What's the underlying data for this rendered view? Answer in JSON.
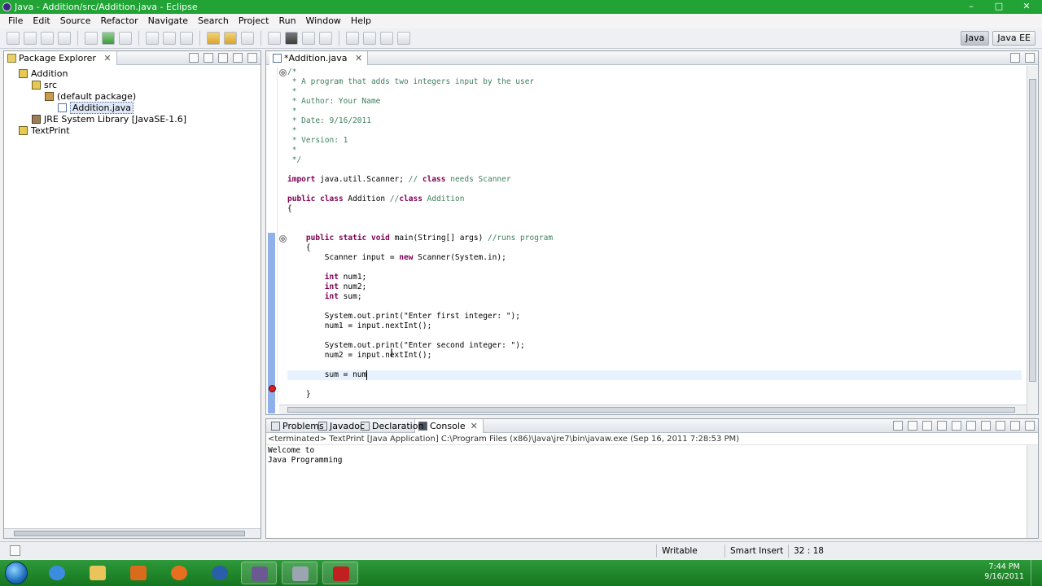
{
  "window": {
    "title": "Java - Addition/src/Addition.java - Eclipse",
    "controls": [
      "–",
      "□",
      "✕"
    ]
  },
  "menubar": [
    "File",
    "Edit",
    "Source",
    "Refactor",
    "Navigate",
    "Search",
    "Project",
    "Run",
    "Window",
    "Help"
  ],
  "perspectives": [
    "Java",
    "Java EE"
  ],
  "package_explorer": {
    "title": "Package Explorer",
    "tree": [
      {
        "label": "Addition",
        "depth": 0,
        "icon": "project-icon"
      },
      {
        "label": "src",
        "depth": 1,
        "icon": "source-folder-icon"
      },
      {
        "label": "(default package)",
        "depth": 2,
        "icon": "package-icon"
      },
      {
        "label": "Addition.java",
        "depth": 3,
        "icon": "java-file-icon",
        "selected": true
      },
      {
        "label": "JRE System Library [JavaSE-1.6]",
        "depth": 1,
        "icon": "library-icon"
      },
      {
        "label": "TextPrint",
        "depth": 0,
        "icon": "project-icon"
      }
    ]
  },
  "editor": {
    "tab": "*Addition.java",
    "lines": [
      {
        "text": "/*",
        "kind": "comment",
        "fold": "⊖"
      },
      {
        "text": " * A program that adds two integers input by the user",
        "kind": "comment"
      },
      {
        "text": " *",
        "kind": "comment"
      },
      {
        "text": " * Author: Your Name",
        "kind": "comment"
      },
      {
        "text": " *",
        "kind": "comment"
      },
      {
        "text": " * Date: 9/16/2011",
        "kind": "comment"
      },
      {
        "text": " *",
        "kind": "comment"
      },
      {
        "text": " * Version: 1",
        "kind": "comment"
      },
      {
        "text": " *",
        "kind": "comment"
      },
      {
        "text": " */",
        "kind": "comment"
      },
      {
        "text": "",
        "kind": "plain"
      },
      {
        "text": "import java.util.Scanner; // class needs Scanner",
        "kind": "plain"
      },
      {
        "text": "",
        "kind": "plain"
      },
      {
        "text": "public class Addition //class Addition",
        "kind": "plain"
      },
      {
        "text": "{",
        "kind": "plain"
      },
      {
        "text": "",
        "kind": "plain"
      },
      {
        "text": "",
        "kind": "plain"
      },
      {
        "text": "    public static void main(String[] args) //runs program",
        "kind": "plain",
        "fold": "⊖"
      },
      {
        "text": "    {",
        "kind": "plain"
      },
      {
        "text": "        Scanner input = new Scanner(System.in);",
        "kind": "plain"
      },
      {
        "text": "",
        "kind": "plain"
      },
      {
        "text": "        int num1;",
        "kind": "plain"
      },
      {
        "text": "        int num2;",
        "kind": "plain"
      },
      {
        "text": "        int sum;",
        "kind": "plain"
      },
      {
        "text": "",
        "kind": "plain"
      },
      {
        "text": "        System.out.print(\"Enter first integer: \");",
        "kind": "plain"
      },
      {
        "text": "        num1 = input.nextInt();",
        "kind": "plain"
      },
      {
        "text": "",
        "kind": "plain"
      },
      {
        "text": "        System.out.print(\"Enter second integer: \");",
        "kind": "plain"
      },
      {
        "text": "        num2 = input.nextInt();",
        "kind": "plain"
      },
      {
        "text": "",
        "kind": "plain"
      },
      {
        "text": "        sum = num",
        "kind": "plain",
        "current": true
      },
      {
        "text": "",
        "kind": "plain"
      },
      {
        "text": "    }",
        "kind": "plain"
      }
    ]
  },
  "bottom_tabs": [
    {
      "label": "Problems",
      "icon": "problems-icon"
    },
    {
      "label": "Javadoc",
      "icon": "javadoc-icon"
    },
    {
      "label": "Declaration",
      "icon": "declaration-icon"
    },
    {
      "label": "Console",
      "icon": "console-icon",
      "active": true
    }
  ],
  "console": {
    "header": "<terminated> TextPrint [Java Application] C:\\Program Files (x86)\\Java\\jre7\\bin\\javaw.exe (Sep 16, 2011 7:28:53 PM)",
    "output": [
      "Welcome to",
      "Java Programming"
    ]
  },
  "status": {
    "writable": "Writable",
    "insert_mode": "Smart Insert",
    "position": "32 : 18"
  },
  "taskbar": {
    "time": "7:44 PM",
    "date": "9/16/2011"
  },
  "colors": {
    "taskbar": "#1a7d25",
    "comment": "#3f7f5f",
    "keyword": "#7f0055",
    "error": "#d42020"
  }
}
